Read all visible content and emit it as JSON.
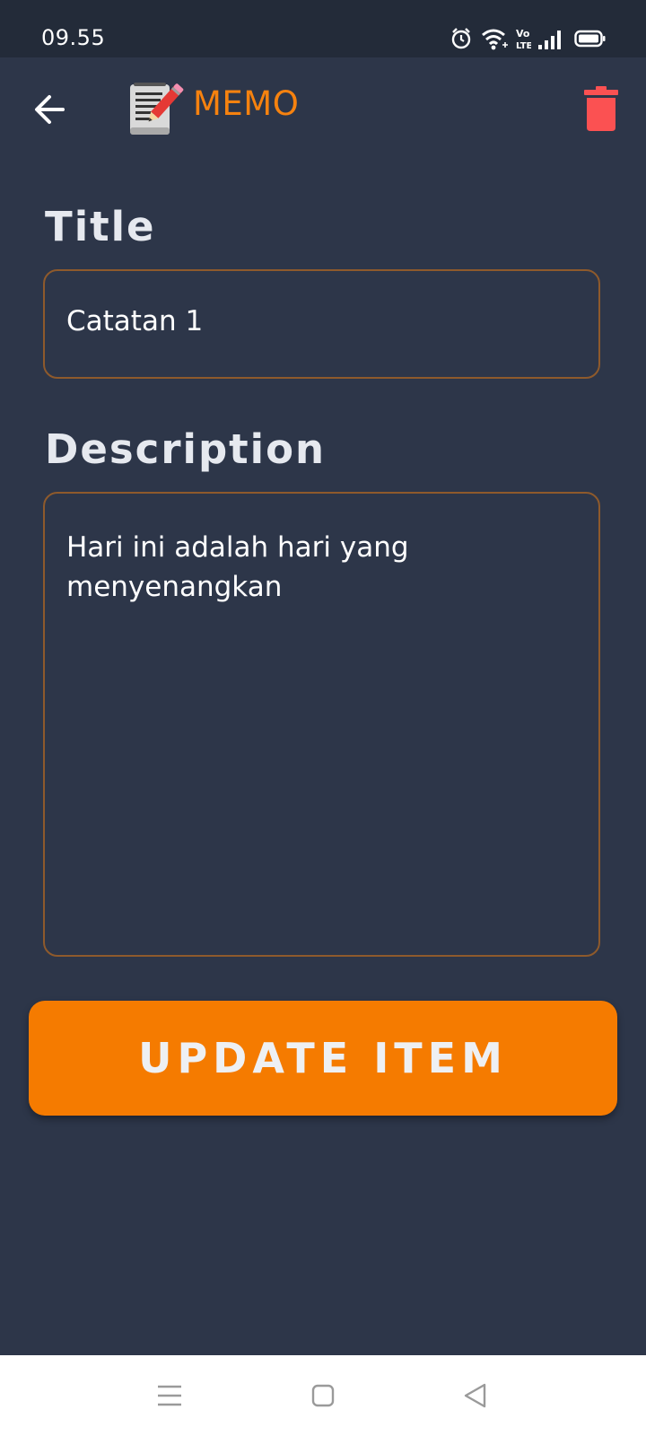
{
  "status_bar": {
    "time": "09.55",
    "icons": [
      "alarm-icon",
      "wifi-icon",
      "volte-icon",
      "signal-icon",
      "battery-icon"
    ],
    "volte_text": "Vo LTE"
  },
  "app_bar": {
    "title": "MEMO",
    "back_icon": "back-arrow-icon",
    "logo_icon": "memo-notepad-icon",
    "delete_icon": "trash-icon"
  },
  "form": {
    "title_label": "Title",
    "title_value": "Catatan 1",
    "description_label": "Description",
    "description_value": "Hari ini adalah hari yang menyenangkan"
  },
  "update_button": {
    "label": "UPDATE ITEM"
  },
  "nav_bar": {
    "items": [
      "menu-icon",
      "home-icon",
      "back-icon"
    ]
  },
  "colors": {
    "background": "#2d3649",
    "status_bar": "#232b39",
    "accent": "#f57b00",
    "field_border": "#8e5a2c",
    "delete": "#fb5152"
  }
}
